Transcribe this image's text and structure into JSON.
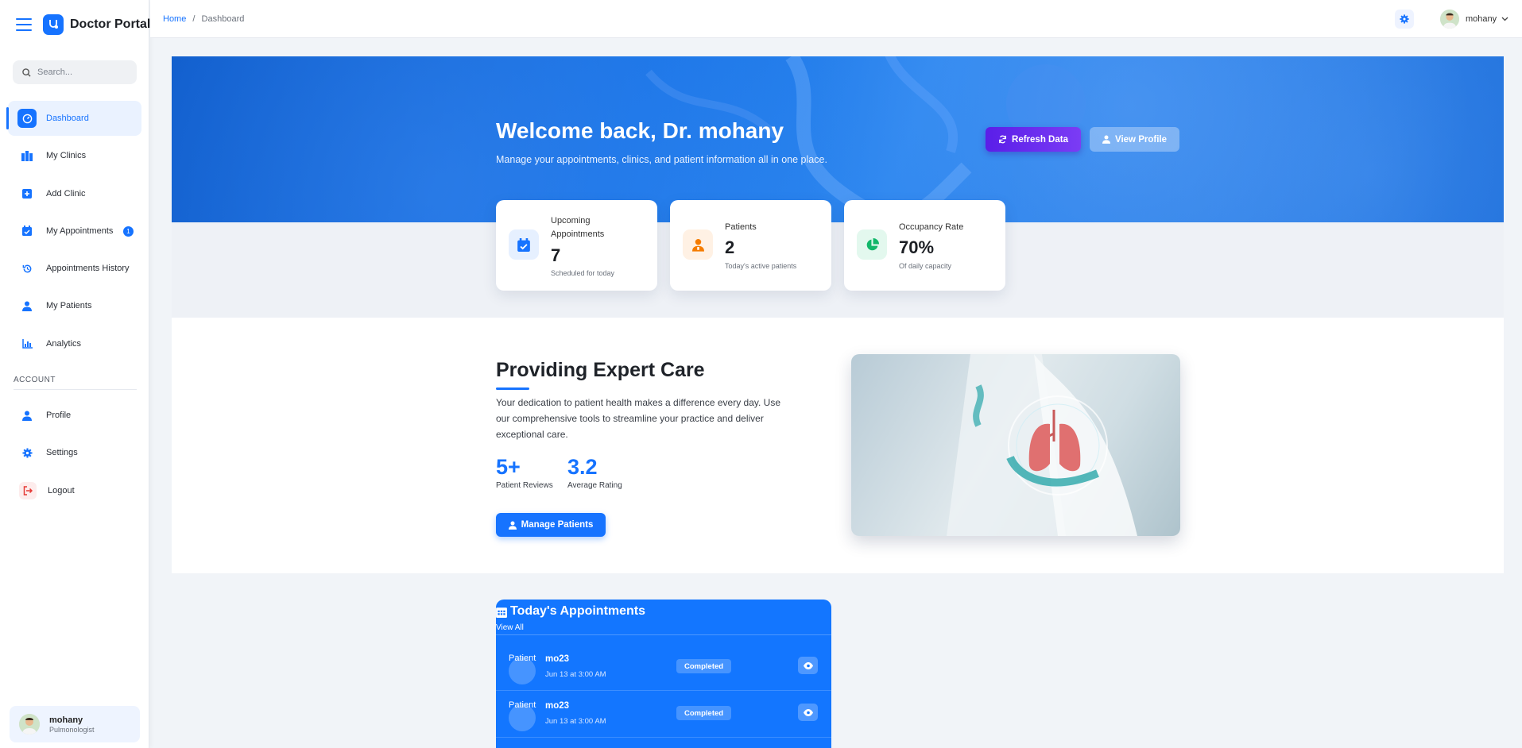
{
  "app": {
    "title": "Doctor Portal"
  },
  "search": {
    "placeholder": "Search..."
  },
  "sidebar": {
    "items": [
      {
        "label": "Dashboard",
        "icon": "gauge-icon",
        "active": true
      },
      {
        "label": "My Clinics",
        "icon": "building-icon"
      },
      {
        "label": "Add Clinic",
        "icon": "plus-square-icon"
      },
      {
        "label": "My Appointments",
        "icon": "calendar-check-icon",
        "badge": "1"
      },
      {
        "label": "Appointments History",
        "icon": "history-icon"
      },
      {
        "label": "My Patients",
        "icon": "user-doctor-icon"
      },
      {
        "label": "Analytics",
        "icon": "bar-chart-icon"
      }
    ],
    "account_label": "ACCOUNT",
    "account_items": [
      {
        "label": "Profile",
        "icon": "user-icon"
      },
      {
        "label": "Settings",
        "icon": "gear-icon"
      },
      {
        "label": "Logout",
        "icon": "logout-icon"
      }
    ],
    "user": {
      "name": "mohany",
      "role": "Pulmonologist"
    }
  },
  "topbar": {
    "breadcrumb_home": "Home",
    "breadcrumb_sep": "/",
    "breadcrumb_current": "Dashboard",
    "user_name": "mohany"
  },
  "hero": {
    "title": "Welcome back, Dr. mohany",
    "subtitle": "Manage your appointments, clinics, and patient information all in one place.",
    "refresh_label": "Refresh Data",
    "view_profile_label": "View Profile"
  },
  "stats": [
    {
      "label": "Upcoming Appointments",
      "value": "7",
      "note": "Scheduled for today",
      "color": "#1673ff"
    },
    {
      "label": "Patients",
      "value": "2",
      "note": "Today's active patients",
      "color": "#f57c00"
    },
    {
      "label": "Occupancy Rate",
      "value": "70%",
      "note": "Of daily capacity",
      "color": "#12b76a"
    }
  ],
  "care": {
    "title": "Providing Expert Care",
    "text": "Your dedication to patient health makes a difference every day. Use our comprehensive tools to streamline your practice and deliver exceptional care.",
    "metrics": [
      {
        "value": "5+",
        "label": "Patient Reviews"
      },
      {
        "value": "3.2",
        "label": "Average Rating"
      }
    ],
    "manage_label": "Manage Patients"
  },
  "appointments": {
    "title": "Today's Appointments",
    "view_all": "View All",
    "rows": [
      {
        "avatar_text": "Patient",
        "name": "mo23",
        "time": "Jun 13 at 3:00 AM",
        "status": "Completed"
      },
      {
        "avatar_text": "Patient",
        "name": "mo23",
        "time": "Jun 13 at 3:00 AM",
        "status": "Completed"
      }
    ]
  },
  "colors": {
    "accent": "#1673ff",
    "purple": "#6a2cf0"
  }
}
